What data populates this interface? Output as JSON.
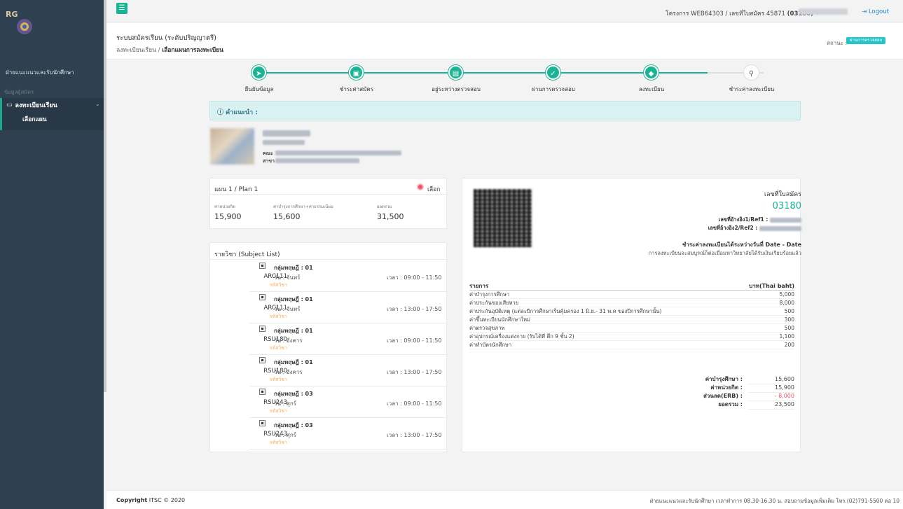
{
  "sidebar": {
    "logo_text": "RG",
    "unit_name": "ฝ่ายแนะแนวและรับนักศึกษา",
    "section_label": "ข้อมูลผู้สมัคร",
    "menu_label": "ลงทะเบียนเรียน",
    "submenu_label": "เลือกแผน"
  },
  "topbar": {
    "project": "โครงการ WEB64303 / เลขที่ใบสมัคร 45871 ",
    "project_code": "(03180)",
    "logout": "Logout"
  },
  "header": {
    "title": "ระบบสมัครเรียน (ระดับปริญญาตรี)",
    "breadcrumb_1": "ลงทะเบียนเรียน",
    "breadcrumb_sep": "/",
    "breadcrumb_2": "เลือกแผนการลงทะเบียน",
    "status_label": "สถานะ :",
    "status_badge": "ผ่านการตรวจสอบ"
  },
  "steps": [
    "ยืนยันข้อมูล",
    "ชำระค่าสมัคร",
    "อยู่ระหว่างตรวจสอบ",
    "ผ่านการตรวจสอบ",
    "ลงทะเบียน",
    "ชำระค่าลงทะเบียน"
  ],
  "alert": {
    "text": "คำแนะนำ :"
  },
  "student": {
    "faculty_label": "คณะ",
    "major_label": "สาขา"
  },
  "plan": {
    "title": "แผน 1 / Plan 1",
    "select_label": "เลือก",
    "col1_label": "ค่าหน่วยกิต",
    "col1_value": "15,900",
    "col2_label": "ค่าบำรุงการศึกษา+ค่าธรรมเนียม",
    "col2_value": "15,600",
    "col3_label": "ยอดรวม",
    "col3_value": "31,500"
  },
  "subjects": {
    "title": "รายวิชา (Subject List)",
    "sub_label": "รหัสวิชา",
    "items": [
      {
        "group": "กลุ่มทฤษฎี : 01",
        "code": "ARC111",
        "day": "วัน : จันทร์",
        "time": "เวลา : 09:00 - 11:50"
      },
      {
        "group": "กลุ่มทฤษฎี : 01",
        "code": "ARC111",
        "day": "วัน : จันทร์",
        "time": "เวลา : 13:00 - 17:50"
      },
      {
        "group": "กลุ่มทฤษฎี : 01",
        "code": "RSU180",
        "day": "วัน : อังคาร",
        "time": "เวลา : 09:00 - 11:50"
      },
      {
        "group": "กลุ่มทฤษฎี : 01",
        "code": "RSU180",
        "day": "วัน : อังคาร",
        "time": "เวลา : 13:00 - 17:50"
      },
      {
        "group": "กลุ่มทฤษฎี : 03",
        "code": "RSU243",
        "day": "วัน : ศุกร์",
        "time": "เวลา : 09:00 - 11:50"
      },
      {
        "group": "กลุ่มทฤษฎี : 03",
        "code": "RSU243",
        "day": "วัน : ศุกร์",
        "time": "เวลา : 13:00 - 17:50"
      }
    ]
  },
  "invoice": {
    "app_no_label": "เลขที่ใบสมัคร",
    "app_no": "03180",
    "ref1_label": "เลขที่อ้างอิง1/Ref1 :",
    "ref2_label": "เลขที่อ้างอิง2/Ref2 :",
    "pay_period": "ชำระค่าลงทะเบียนได้ระหว่างวันที่ Date - Date",
    "note": "การลงทะเบียนจะสมบูรณ์ก็ต่อเมื่อมหาวิทยาลัยได้รับเงินเรียบร้อยแล้ว",
    "table_head_item": "รายการ",
    "table_head_amount": "บาท(Thai baht)",
    "rows": [
      {
        "item": "ค่าบำรุงการศึกษา",
        "amount": "5,000"
      },
      {
        "item": "ค่าประกันของเสียหาย",
        "amount": "8,000"
      },
      {
        "item": "ค่าประกันอุบัติเหตุ (แต่ละปีการศึกษาเริ่มคุ้มครอง 1 มิ.ย.- 31 พ.ค ของปีการศึกษานั้น)",
        "amount": "500"
      },
      {
        "item": "ค่าขึ้นทะเบียนนักศึกษาใหม่",
        "amount": "300"
      },
      {
        "item": "ค่าตรวจสุขภาพ",
        "amount": "500"
      },
      {
        "item": "ค่าอุปกรณ์เครื่องแต่งกาย (รับได้ที่ ตึก 9 ชั้น 2)",
        "amount": "1,100"
      },
      {
        "item": "ค่าทำบัตรนักศึกษา",
        "amount": "200"
      }
    ],
    "summary": [
      {
        "label": "ค่าบำรุงศึกษา :",
        "value": "15,600"
      },
      {
        "label": "ค่าหน่วยกิต :",
        "value": "15,900"
      },
      {
        "label": "ส่วนลด(ERB) :",
        "value": "- 8,000"
      },
      {
        "label": "ยอดรวม :",
        "value": "23,500"
      }
    ]
  },
  "footer": {
    "copyright_bold": "Copyright",
    "copyright_rest": " ITSC © 2020",
    "right": "ฝ่ายแนะแนวและรับนักศึกษา เวลาทำการ 08.30-16.30 น. สอบถามข้อมูลเพิ่มเติม โทร.(02)791-5500 ต่อ 10"
  },
  "colors": {
    "accent": "#1ab394",
    "sidebar": "#2f4050",
    "badge": "#23c6c8",
    "danger": "#ed5565",
    "warning": "#f8ac59"
  }
}
